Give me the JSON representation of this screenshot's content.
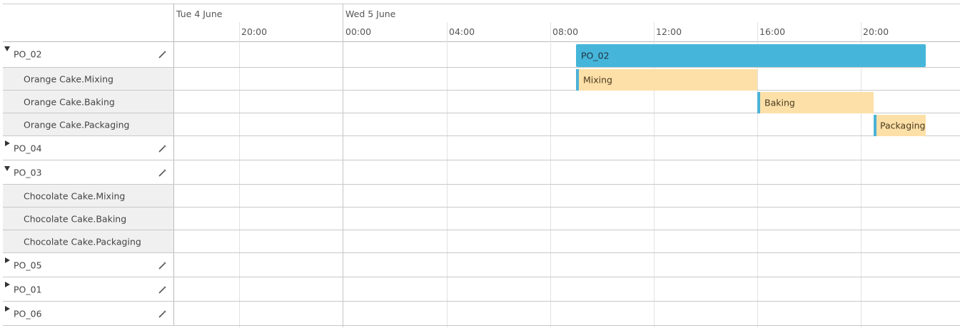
{
  "timeline": {
    "days": [
      "Tue 4 June",
      "Wed 5 June"
    ],
    "hours": [
      "20:00",
      "00:00",
      "04:00",
      "08:00",
      "12:00",
      "16:00",
      "20:00"
    ]
  },
  "rows": [
    {
      "type": "parent",
      "label": "PO_02",
      "expanded": true
    },
    {
      "type": "child",
      "label": "Orange Cake.Mixing"
    },
    {
      "type": "child",
      "label": "Orange Cake.Baking"
    },
    {
      "type": "child",
      "label": "Orange Cake.Packaging"
    },
    {
      "type": "parent",
      "label": "PO_04",
      "expanded": false
    },
    {
      "type": "parent",
      "label": "PO_03",
      "expanded": true
    },
    {
      "type": "child",
      "label": "Chocolate Cake.Mixing"
    },
    {
      "type": "child",
      "label": "Chocolate Cake.Baking"
    },
    {
      "type": "child",
      "label": "Chocolate Cake.Packaging"
    },
    {
      "type": "parent",
      "label": "PO_05",
      "expanded": false
    },
    {
      "type": "parent",
      "label": "PO_01",
      "expanded": false
    },
    {
      "type": "parent",
      "label": "PO_06",
      "expanded": false
    }
  ],
  "bars": [
    {
      "label": "PO_02",
      "kind": "summary",
      "start": "Wed 08:45",
      "end": "Wed 22:45"
    },
    {
      "label": "Mixing",
      "kind": "task",
      "start": "Wed 08:45",
      "end": "Wed 16:00"
    },
    {
      "label": "Baking",
      "kind": "task",
      "start": "Wed 16:00",
      "end": "Wed 20:30"
    },
    {
      "label": "Packaging",
      "kind": "task",
      "start": "Wed 20:30",
      "end": "Wed 22:45"
    }
  ],
  "colors": {
    "summary_bar": "#45b6da",
    "task_bar": "#fde0a8",
    "task_marker": "#4cb2d6",
    "child_row_bg": "#f0f0f0"
  },
  "icons": {
    "expanded": "triangle-down",
    "collapsed": "triangle-right",
    "action": "magic-wand-icon"
  }
}
